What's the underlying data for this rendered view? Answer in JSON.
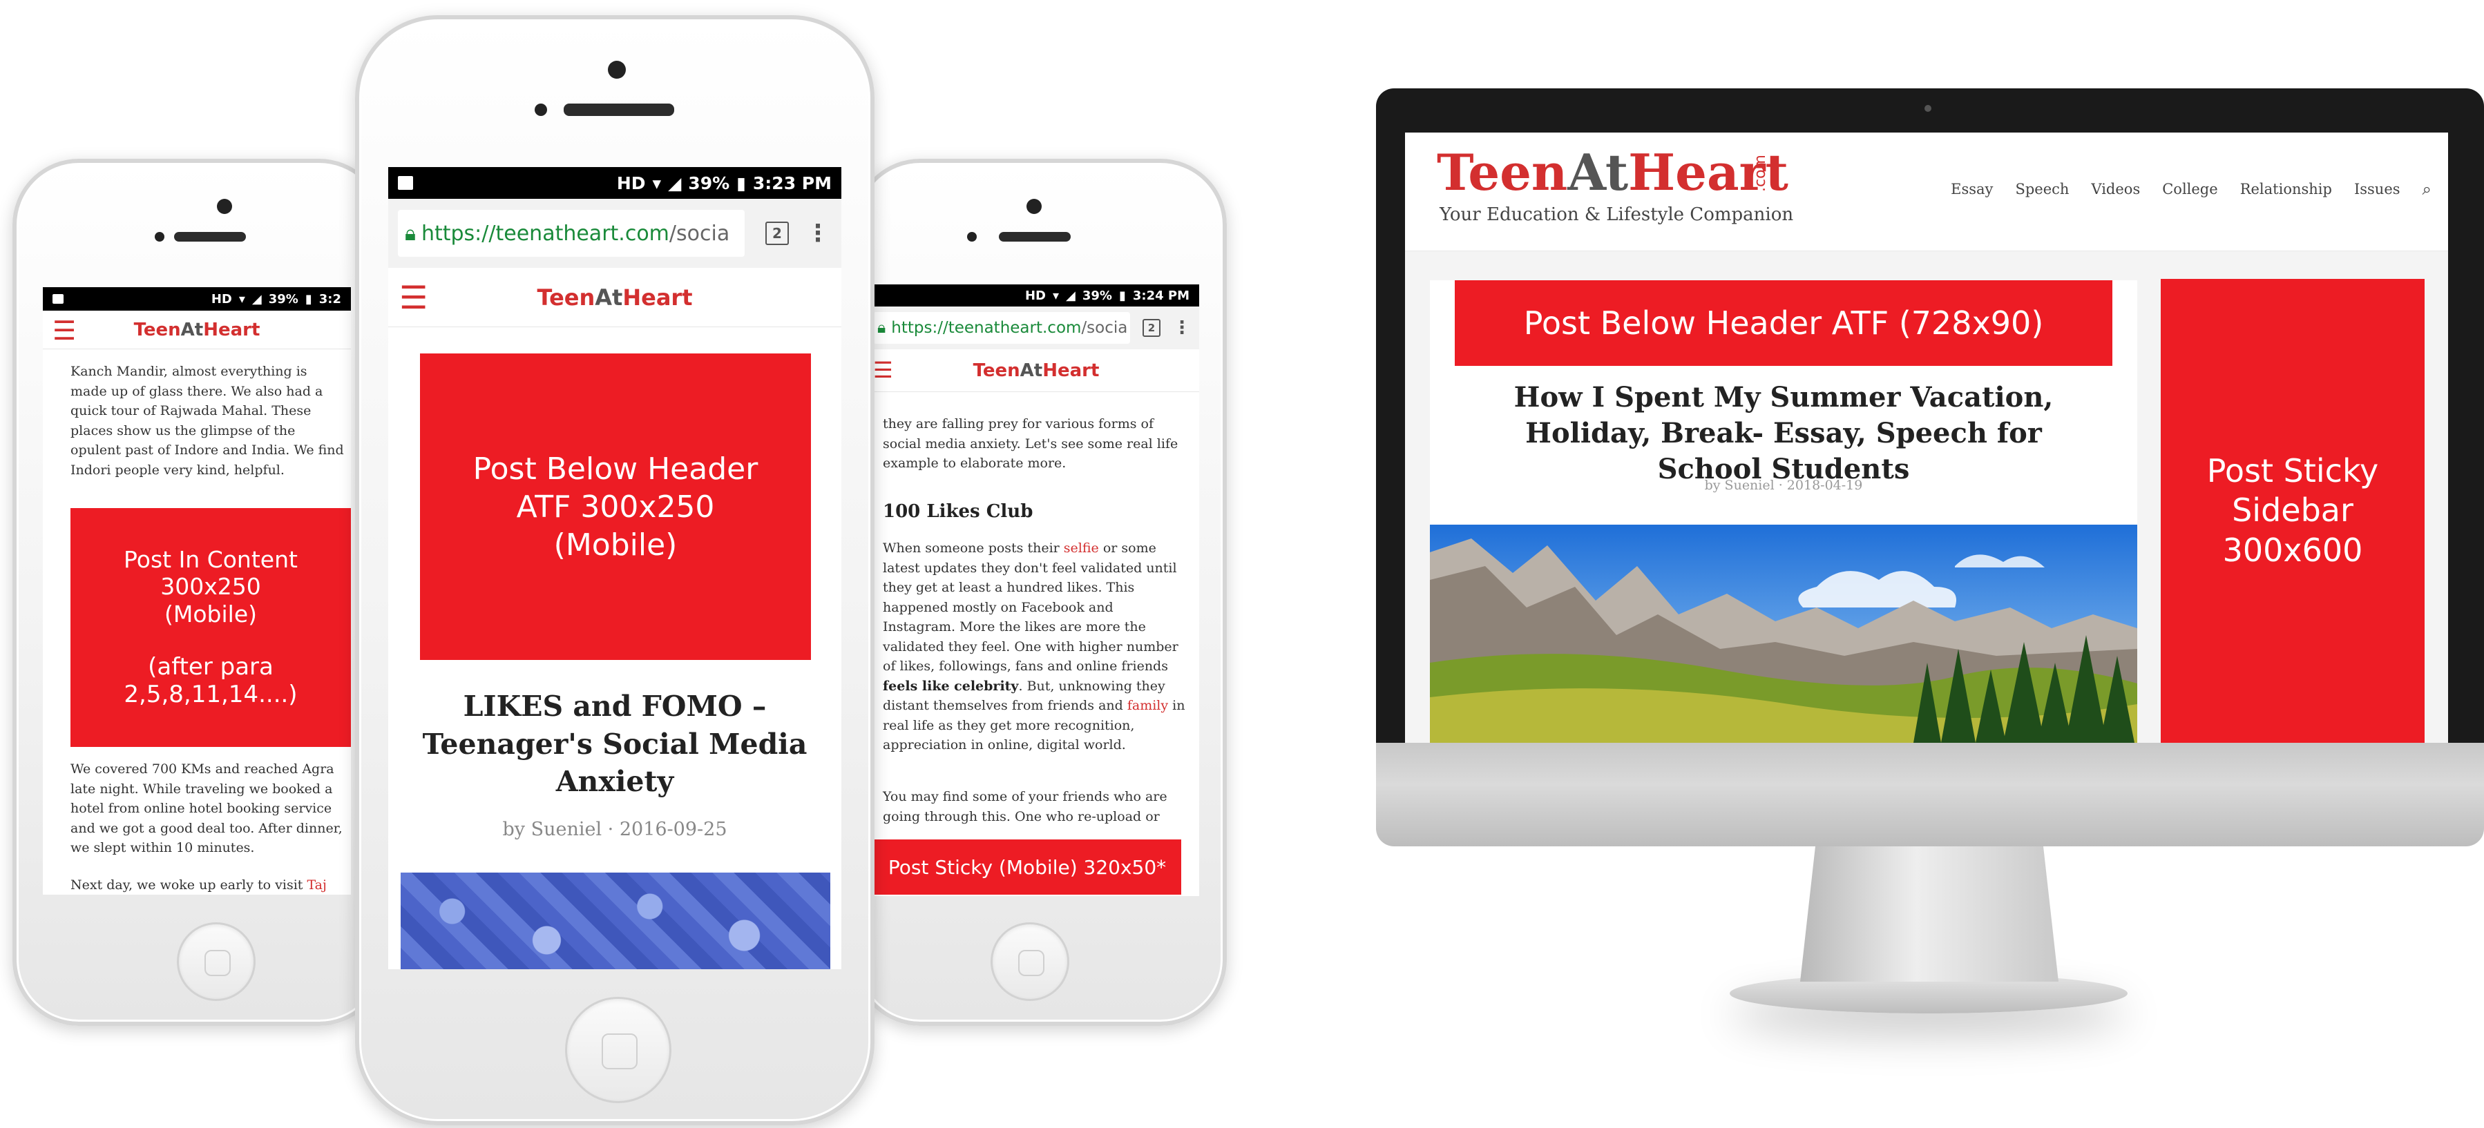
{
  "phone_left": {
    "status_percent": "39%",
    "status_time": "3:2",
    "brand": {
      "teen": "Teen",
      "at": "At",
      "heart": "Heart"
    },
    "para1": "Kanch Mandir, almost everything is made up of glass there. We also had a quick tour of Rajwada Mahal. These places show us the glimpse of the opulent past of Indore and India. We find Indori people very kind, helpful.",
    "ad": {
      "line1": "Post In Content",
      "line2": "300x250",
      "line3": "(Mobile)",
      "line4": "(after para 2,5,8,11,14....)"
    },
    "para2": "We covered 700 KMs and reached Agra late night. While traveling we booked a hotel from online hotel booking service and we got a good deal too. After dinner, we slept within 10 minutes.",
    "para3_prefix": "Next day, we woke up early to visit ",
    "para3_link": "Taj"
  },
  "phone_center": {
    "status_percent": "39%",
    "status_time": "3:23 PM",
    "url_host": "https://teenatheart.com",
    "url_rest": "/socia",
    "tab_count": "2",
    "brand": {
      "teen": "Teen",
      "at": "At",
      "heart": "Heart"
    },
    "ad": {
      "line1": "Post Below Header",
      "line2": "ATF 300x250",
      "line3": "(Mobile)"
    },
    "title": "LIKES and FOMO – Teenager's Social Media Anxiety",
    "byline": "by Sueniel · 2016-09-25"
  },
  "phone_right": {
    "status_percent": "39%",
    "status_time": "3:24 PM",
    "url_host": "https://teenatheart.com",
    "url_rest": "/socia",
    "tab_count": "2",
    "brand": {
      "teen": "Teen",
      "at": "At",
      "heart": "Heart"
    },
    "para1": "they are falling prey for various forms of social media anxiety. Let's see some real life example to elaborate more.",
    "heading": "100 Likes Club",
    "para2_a": "When someone posts their ",
    "para2_link1": "selfie",
    "para2_b": " or some latest updates they don't feel validated until they get at least a hundred likes. This happened mostly on Facebook and Instagram. More the likes are more the validated they feel. One with higher number of likes, followings, fans and online friends ",
    "para2_bold": "feels like celebrity",
    "para2_c": ". But, unknowing they distant themselves from friends and ",
    "para2_link2": "family",
    "para2_d": " in real life as they get more recognition, appreciation in online, digital world.",
    "para3": "You may find some of your friends who are going through this. One who re-upload or",
    "sticky_ad": "Post Sticky (Mobile) 320x50*"
  },
  "desktop": {
    "logo": {
      "teen": "Teen",
      "at": "At",
      "heart": "Heart",
      "com": ".com"
    },
    "tagline": "Your Education & Lifestyle Companion",
    "nav": [
      "Essay",
      "Speech",
      "Videos",
      "College",
      "Relationship",
      "Issues"
    ],
    "header_ad": "Post Below Header ATF (728x90)",
    "title": "How I Spent My Summer Vacation, Holiday, Break- Essay, Speech for School Students",
    "byline": "by Sueniel · 2018-04-19",
    "sidebar_ad": {
      "line1": "Post Sticky",
      "line2": "Sidebar",
      "line3": "300x600"
    }
  },
  "colors": {
    "brand_red": "#d32f2f",
    "ad_red": "#ed1c24",
    "url_green": "#1a8a3a"
  }
}
